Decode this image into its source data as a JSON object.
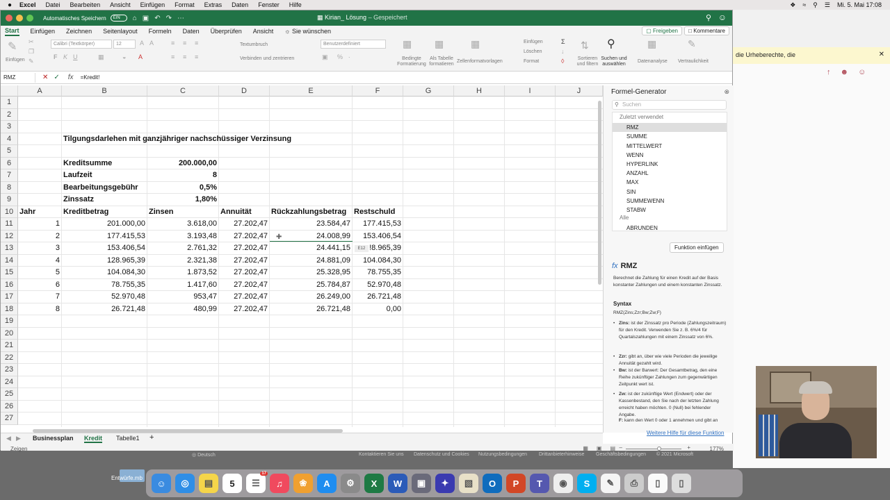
{
  "menubar": {
    "apple": "",
    "items": [
      "Excel",
      "Datei",
      "Bearbeiten",
      "Ansicht",
      "Einfügen",
      "Format",
      "Extras",
      "Daten",
      "Fenster",
      "Hilfe"
    ],
    "clock": "Mi. 5. Mai 17:08"
  },
  "titlebar": {
    "autosave_label": "Automatisches Speichern",
    "autosave_state": "EIN",
    "doc_title": "Kirian_ Lösung",
    "saved_state": "– Gespeichert"
  },
  "ribbon_tabs": [
    "Start",
    "Einfügen",
    "Zeichnen",
    "Seitenlayout",
    "Formeln",
    "Daten",
    "Überprüfen",
    "Ansicht",
    "Sie wünschen"
  ],
  "share_label": "Freigeben",
  "comments_label": "Kommentare",
  "ribbon": {
    "paste": "Einfügen",
    "font_name": "Calibri (Textkörper)",
    "font_size": "12",
    "wrap_text": "Textumbruch",
    "merge_center": "Verbinden und zentrieren",
    "number_format": "Benutzerdefiniert",
    "conditional_format": "Bedingte Formatierung",
    "as_table": "Als Tabelle formatieren",
    "cell_styles": "Zellenformatvorlagen",
    "insert": "Einfügen",
    "delete": "Löschen",
    "format": "Format",
    "sort_filter": "Sortieren und filtern",
    "find_select": "Suchen und auswählen",
    "data_analysis": "Datenanalyse",
    "sensitivity": "Vertraulichkeit"
  },
  "formula_bar": {
    "name_box": "RMZ",
    "formula": "=Kredit!"
  },
  "columns": [
    "A",
    "B",
    "C",
    "D",
    "E",
    "F",
    "G",
    "H",
    "I",
    "J"
  ],
  "rows": [
    "1",
    "2",
    "3",
    "4",
    "5",
    "6",
    "7",
    "8",
    "9",
    "10",
    "11",
    "12",
    "13",
    "14",
    "15",
    "16",
    "17",
    "18",
    "19",
    "20",
    "21",
    "22",
    "23",
    "24",
    "25",
    "26",
    "27"
  ],
  "sheet": {
    "title": "Tilgungsdarlehen mit ganzjähriger nachschüssiger Verzinsung",
    "params": [
      {
        "label": "Kreditsumme",
        "value": "200.000,00"
      },
      {
        "label": "Laufzeit",
        "value": "8"
      },
      {
        "label": "Bearbeitungsgebühr",
        "value": "0,5%"
      },
      {
        "label": "Zinssatz",
        "value": "1,80%"
      }
    ],
    "headers": [
      "Jahr",
      "Kreditbetrag",
      "Zinsen",
      "Annuität",
      "Rückzahlungsbetrag",
      "Restschuld"
    ],
    "table": [
      [
        "1",
        "201.000,00",
        "3.618,00",
        "27.202,47",
        "23.584,47",
        "177.415,53"
      ],
      [
        "2",
        "177.415,53",
        "3.193,48",
        "27.202,47",
        "24.008,99",
        "153.406,54"
      ],
      [
        "3",
        "153.406,54",
        "2.761,32",
        "27.202,47",
        "24.441,15",
        "!8.965,39"
      ],
      [
        "4",
        "128.965,39",
        "2.321,38",
        "27.202,47",
        "24.881,09",
        "104.084,30"
      ],
      [
        "5",
        "104.084,30",
        "1.873,52",
        "27.202,47",
        "25.328,95",
        "78.755,35"
      ],
      [
        "6",
        "78.755,35",
        "1.417,60",
        "27.202,47",
        "25.784,87",
        "52.970,48"
      ],
      [
        "7",
        "52.970,48",
        "953,47",
        "27.202,47",
        "26.249,00",
        "26.721,48"
      ],
      [
        "8",
        "26.721,48",
        "480,99",
        "27.202,47",
        "26.721,48",
        "0,00"
      ]
    ],
    "cell_tooltip": "E12"
  },
  "sheet_tabs": [
    "Businessplan",
    "Kredit",
    "Tabelle1"
  ],
  "add_sheet": "+",
  "status": {
    "ready": "Zeigen",
    "zoom": "177%"
  },
  "formula_panel": {
    "title": "Formel-Generator",
    "search_placeholder": "Suchen",
    "recent_label": "Zuletzt verwendet",
    "recent": [
      "RMZ",
      "SUMME",
      "MITTELWERT",
      "WENN",
      "HYPERLINK",
      "ANZAHL",
      "MAX",
      "SIN",
      "SUMMEWENN",
      "STABW"
    ],
    "all_label": "Alle",
    "all": [
      "ABRUNDEN"
    ],
    "insert_button": "Funktion einfügen",
    "fx_symbol": "fx",
    "function_name": "RMZ",
    "description": "Berechnet die Zahlung für einen Kredit auf der Basis konstanter Zahlungen und einem konstanten Zinssatz.",
    "syntax_label": "Syntax",
    "syntax": "RMZ(Zins;Zzr;Bw;Zw;F)",
    "args": [
      {
        "name": "Zins:",
        "text": "ist der Zinssatz pro Periode (Zahlungszeitraum) für den Kredit. Verwenden Sie z. B. 6%/4 für Quartalszahlungen mit einem Zinssatz von 6%."
      },
      {
        "name": "Zzr:",
        "text": "gibt an, über wie viele Perioden die jeweilige Annuität gezahlt wird."
      },
      {
        "name": "Bw:",
        "text": "ist der Barwert: Der Gesamtbetrag, den eine Reihe zukünftiger Zahlungen zum gegenwärtigen Zeitpunkt wert ist."
      },
      {
        "name": "Zw:",
        "text": "ist der zukünftige Wert (Endwert) oder der Kassenbestand, den Sie nach der letzten Zahlung erreicht haben möchten. 0 (Null) bei fehlender Angabe."
      },
      {
        "name": "F:",
        "text": "kann den Wert 0 oder 1 annehmen und gibt an"
      }
    ],
    "more_help": "Weitere Hilfe für diese Funktion"
  },
  "browser": {
    "infobar": "die Urheberechte, die"
  },
  "footer": {
    "lang": "Deutsch",
    "links": [
      "Kontaktieren Sie uns",
      "Datenschutz und Cookies",
      "Nutzungsbedingungen",
      "Drittanbieterhinweise",
      "Geschäftsbedingungen",
      "© 2021 Microsoft"
    ]
  },
  "desktop_file": "Entwürfe.mb",
  "dock": {
    "calendar_day": "5",
    "badge_reminders": "17",
    "apps": [
      "Finder",
      "Safari",
      "Notizen",
      "Kalender",
      "Erinnerungen",
      "Musik",
      "Fotos",
      "App Store",
      "Systemeinstellungen",
      "Excel",
      "Word",
      "Remote",
      "Arc",
      "Vorschau",
      "Outlook",
      "PowerPoint",
      "Teams",
      "Chrome",
      "Skype",
      "TextEdit",
      "Drucker",
      "Dokument",
      "Papierkorb"
    ]
  }
}
